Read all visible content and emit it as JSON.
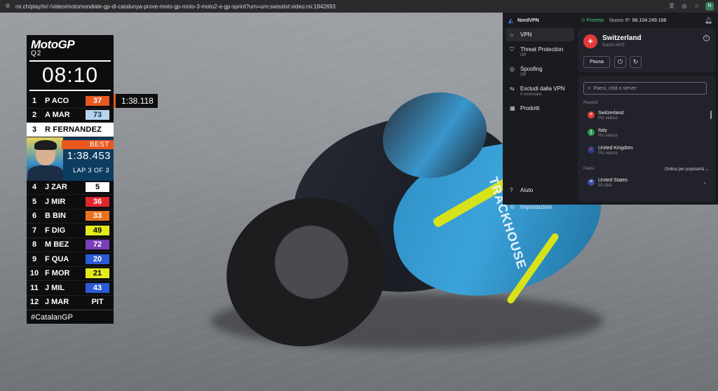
{
  "browser": {
    "url": "rsi.ch/play/tv/-/video/motomondiale-gp-di-catalunya-prove-moto-gp-moto-3-moto2-e-gp-sprint?urn=urn:swisstxt:video:rsi:1842693"
  },
  "video": {
    "suit_text": "TRACKHOUSE"
  },
  "leaderboard": {
    "brand": "MotoGP",
    "session": "Q2",
    "timer": "08:10",
    "rows_top": [
      {
        "pos": "1",
        "driver": "P ACO",
        "num": "37",
        "num_bg": "#e8581f",
        "num_fg": "#ffffff",
        "extra": "1:38.118"
      },
      {
        "pos": "2",
        "driver": "A MAR",
        "num": "73",
        "num_bg": "#b9d3ea",
        "num_fg": "#0d3c61"
      }
    ],
    "active_row": {
      "pos": "3",
      "driver": "R FERNANDEZ"
    },
    "best": {
      "badge": "BEST",
      "time": "1:38.453",
      "lap": "LAP 3 OF 3"
    },
    "rows_bottom": [
      {
        "pos": "4",
        "driver": "J ZAR",
        "num": "5",
        "num_bg": "#ffffff",
        "num_fg": "#000000"
      },
      {
        "pos": "5",
        "driver": "J MIR",
        "num": "36",
        "num_bg": "#e0262f",
        "num_fg": "#ffffff"
      },
      {
        "pos": "6",
        "driver": "B BIN",
        "num": "33",
        "num_bg": "#e8731f",
        "num_fg": "#ffffff"
      },
      {
        "pos": "7",
        "driver": "F DIG",
        "num": "49",
        "num_bg": "#e2ea1b",
        "num_fg": "#000000"
      },
      {
        "pos": "8",
        "driver": "M BEZ",
        "num": "72",
        "num_bg": "#7b3fb8",
        "num_fg": "#ffffff"
      },
      {
        "pos": "9",
        "driver": "F QUA",
        "num": "20",
        "num_bg": "#2a5bd4",
        "num_fg": "#ffffff"
      },
      {
        "pos": "10",
        "driver": "F MOR",
        "num": "21",
        "num_bg": "#e2ea1b",
        "num_fg": "#000000"
      },
      {
        "pos": "11",
        "driver": "J MIL",
        "num": "43",
        "num_bg": "#2a5bd4",
        "num_fg": "#ffffff"
      },
      {
        "pos": "12",
        "driver": "J MAR",
        "num": "PIT",
        "num_bg": "#0d0d0f",
        "num_fg": "#ffffff"
      }
    ],
    "hashtag": "#CatalanGP"
  },
  "vpn": {
    "brand": "NordVPN",
    "status": "Protetta",
    "ip_label": "Nuovo IP:",
    "ip": "86.104.249.168",
    "nav": [
      {
        "label": "VPN",
        "sub": "",
        "icon": "home-icon"
      },
      {
        "label": "Threat Protection",
        "sub": "Off",
        "icon": "shield-icon"
      },
      {
        "label": "Spoofing",
        "sub": "Off",
        "icon": "eye-off-icon"
      },
      {
        "label": "Escludi dalla VPN",
        "sub": "0 esclusa/e",
        "icon": "split-tunnel-icon"
      },
      {
        "label": "Prodotti",
        "sub": "",
        "icon": "grid-icon"
      }
    ],
    "help": "Aiuto",
    "settings": "Impostazioni",
    "current": {
      "country": "Switzerland",
      "server": "Zurich #475"
    },
    "pause": "Pausa",
    "search_placeholder": "Paesi, città o server",
    "recent_label": "Recenti",
    "recent": [
      {
        "name": "Switzerland",
        "sub": "Più veloce",
        "flag_bg": "#e33b3b",
        "flag_fg": "#ffffff",
        "flag_char": "+"
      },
      {
        "name": "Italy",
        "sub": "Più veloce",
        "flag_bg": "#2f9a4a",
        "flag_fg": "#ffffff",
        "flag_char": "|"
      },
      {
        "name": "United Kingdom",
        "sub": "Più veloce",
        "flag_bg": "#1f3f8f",
        "flag_fg": "#e33b3b",
        "flag_char": "✕"
      }
    ],
    "countries_label": "Paesi",
    "sort_label": "Ordina per popolarità",
    "countries": [
      {
        "name": "United States",
        "sub": "55 città",
        "flag_bg": "#3a4fa0",
        "flag_fg": "#ffffff",
        "flag_char": "≡"
      }
    ]
  }
}
